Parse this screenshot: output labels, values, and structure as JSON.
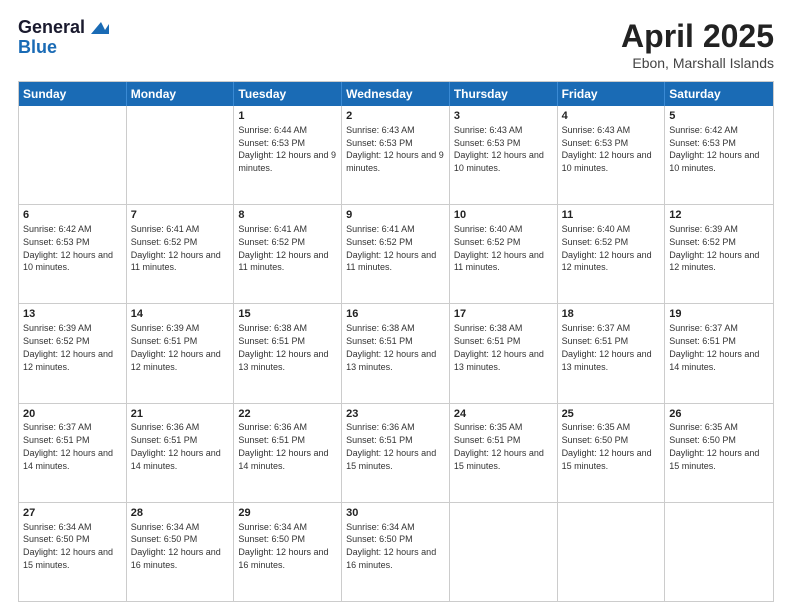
{
  "logo": {
    "general": "General",
    "blue": "Blue"
  },
  "title": "April 2025",
  "location": "Ebon, Marshall Islands",
  "days_of_week": [
    "Sunday",
    "Monday",
    "Tuesday",
    "Wednesday",
    "Thursday",
    "Friday",
    "Saturday"
  ],
  "weeks": [
    [
      {
        "day": "",
        "text": ""
      },
      {
        "day": "",
        "text": ""
      },
      {
        "day": "1",
        "text": "Sunrise: 6:44 AM\nSunset: 6:53 PM\nDaylight: 12 hours and 9 minutes."
      },
      {
        "day": "2",
        "text": "Sunrise: 6:43 AM\nSunset: 6:53 PM\nDaylight: 12 hours and 9 minutes."
      },
      {
        "day": "3",
        "text": "Sunrise: 6:43 AM\nSunset: 6:53 PM\nDaylight: 12 hours and 10 minutes."
      },
      {
        "day": "4",
        "text": "Sunrise: 6:43 AM\nSunset: 6:53 PM\nDaylight: 12 hours and 10 minutes."
      },
      {
        "day": "5",
        "text": "Sunrise: 6:42 AM\nSunset: 6:53 PM\nDaylight: 12 hours and 10 minutes."
      }
    ],
    [
      {
        "day": "6",
        "text": "Sunrise: 6:42 AM\nSunset: 6:53 PM\nDaylight: 12 hours and 10 minutes."
      },
      {
        "day": "7",
        "text": "Sunrise: 6:41 AM\nSunset: 6:52 PM\nDaylight: 12 hours and 11 minutes."
      },
      {
        "day": "8",
        "text": "Sunrise: 6:41 AM\nSunset: 6:52 PM\nDaylight: 12 hours and 11 minutes."
      },
      {
        "day": "9",
        "text": "Sunrise: 6:41 AM\nSunset: 6:52 PM\nDaylight: 12 hours and 11 minutes."
      },
      {
        "day": "10",
        "text": "Sunrise: 6:40 AM\nSunset: 6:52 PM\nDaylight: 12 hours and 11 minutes."
      },
      {
        "day": "11",
        "text": "Sunrise: 6:40 AM\nSunset: 6:52 PM\nDaylight: 12 hours and 12 minutes."
      },
      {
        "day": "12",
        "text": "Sunrise: 6:39 AM\nSunset: 6:52 PM\nDaylight: 12 hours and 12 minutes."
      }
    ],
    [
      {
        "day": "13",
        "text": "Sunrise: 6:39 AM\nSunset: 6:52 PM\nDaylight: 12 hours and 12 minutes."
      },
      {
        "day": "14",
        "text": "Sunrise: 6:39 AM\nSunset: 6:51 PM\nDaylight: 12 hours and 12 minutes."
      },
      {
        "day": "15",
        "text": "Sunrise: 6:38 AM\nSunset: 6:51 PM\nDaylight: 12 hours and 13 minutes."
      },
      {
        "day": "16",
        "text": "Sunrise: 6:38 AM\nSunset: 6:51 PM\nDaylight: 12 hours and 13 minutes."
      },
      {
        "day": "17",
        "text": "Sunrise: 6:38 AM\nSunset: 6:51 PM\nDaylight: 12 hours and 13 minutes."
      },
      {
        "day": "18",
        "text": "Sunrise: 6:37 AM\nSunset: 6:51 PM\nDaylight: 12 hours and 13 minutes."
      },
      {
        "day": "19",
        "text": "Sunrise: 6:37 AM\nSunset: 6:51 PM\nDaylight: 12 hours and 14 minutes."
      }
    ],
    [
      {
        "day": "20",
        "text": "Sunrise: 6:37 AM\nSunset: 6:51 PM\nDaylight: 12 hours and 14 minutes."
      },
      {
        "day": "21",
        "text": "Sunrise: 6:36 AM\nSunset: 6:51 PM\nDaylight: 12 hours and 14 minutes."
      },
      {
        "day": "22",
        "text": "Sunrise: 6:36 AM\nSunset: 6:51 PM\nDaylight: 12 hours and 14 minutes."
      },
      {
        "day": "23",
        "text": "Sunrise: 6:36 AM\nSunset: 6:51 PM\nDaylight: 12 hours and 15 minutes."
      },
      {
        "day": "24",
        "text": "Sunrise: 6:35 AM\nSunset: 6:51 PM\nDaylight: 12 hours and 15 minutes."
      },
      {
        "day": "25",
        "text": "Sunrise: 6:35 AM\nSunset: 6:50 PM\nDaylight: 12 hours and 15 minutes."
      },
      {
        "day": "26",
        "text": "Sunrise: 6:35 AM\nSunset: 6:50 PM\nDaylight: 12 hours and 15 minutes."
      }
    ],
    [
      {
        "day": "27",
        "text": "Sunrise: 6:34 AM\nSunset: 6:50 PM\nDaylight: 12 hours and 15 minutes."
      },
      {
        "day": "28",
        "text": "Sunrise: 6:34 AM\nSunset: 6:50 PM\nDaylight: 12 hours and 16 minutes."
      },
      {
        "day": "29",
        "text": "Sunrise: 6:34 AM\nSunset: 6:50 PM\nDaylight: 12 hours and 16 minutes."
      },
      {
        "day": "30",
        "text": "Sunrise: 6:34 AM\nSunset: 6:50 PM\nDaylight: 12 hours and 16 minutes."
      },
      {
        "day": "",
        "text": ""
      },
      {
        "day": "",
        "text": ""
      },
      {
        "day": "",
        "text": ""
      }
    ]
  ]
}
